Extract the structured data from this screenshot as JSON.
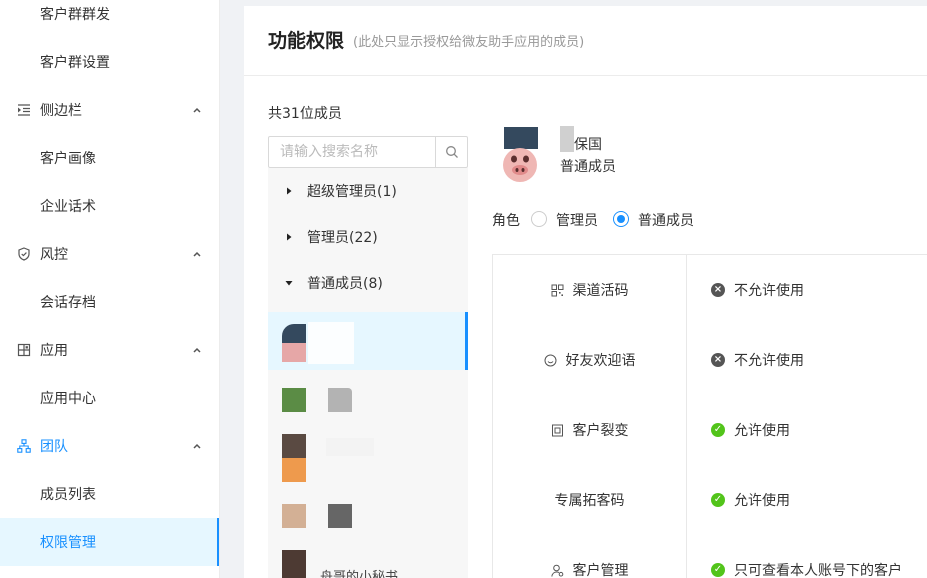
{
  "sidebar": {
    "items": [
      {
        "label": "客户群群发",
        "kind": "sub"
      },
      {
        "label": "客户群设置",
        "kind": "sub"
      },
      {
        "label": "侧边栏",
        "kind": "group",
        "icon": "indent-icon"
      },
      {
        "label": "客户画像",
        "kind": "sub"
      },
      {
        "label": "企业话术",
        "kind": "sub"
      },
      {
        "label": "风控",
        "kind": "group",
        "icon": "shield-icon"
      },
      {
        "label": "会话存档",
        "kind": "sub"
      },
      {
        "label": "应用",
        "kind": "group",
        "icon": "apps-icon"
      },
      {
        "label": "应用中心",
        "kind": "sub"
      },
      {
        "label": "团队",
        "kind": "group",
        "icon": "org-icon"
      },
      {
        "label": "成员列表",
        "kind": "sub"
      },
      {
        "label": "权限管理",
        "kind": "sub"
      }
    ]
  },
  "header": {
    "title": "功能权限",
    "subtitle": "(此处只显示授权给微友助手应用的成员)"
  },
  "members": {
    "count_label": "共31位成员",
    "search_placeholder": "请输入搜索名称",
    "groups": [
      {
        "label": "超级管理员(1)",
        "expanded": false
      },
      {
        "label": "管理员(22)",
        "expanded": false
      },
      {
        "label": "普通成员(8)",
        "expanded": true
      }
    ],
    "rows": [
      {
        "name": "",
        "selected": true
      },
      {
        "name": "",
        "selected": false
      },
      {
        "name": "",
        "selected": false
      },
      {
        "name": "",
        "selected": false
      },
      {
        "name": "舟哥的小秘书",
        "selected": false
      }
    ]
  },
  "detail": {
    "name": "保国",
    "role_text": "普通成员",
    "role_label": "角色",
    "role_options": [
      {
        "label": "管理员",
        "checked": false
      },
      {
        "label": "普通成员",
        "checked": true
      }
    ]
  },
  "permissions": [
    {
      "feature": "渠道活码",
      "icon": "qrcode-icon",
      "status": "不允许使用",
      "allowed": false
    },
    {
      "feature": "好友欢迎语",
      "icon": "smile-icon",
      "status": "不允许使用",
      "allowed": false
    },
    {
      "feature": "客户裂变",
      "icon": "split-icon",
      "status": "允许使用",
      "allowed": true
    },
    {
      "feature": "专属拓客码",
      "icon": "",
      "status": "允许使用",
      "allowed": true
    },
    {
      "feature": "客户管理",
      "icon": "user-manage-icon",
      "status": "只可查看本人账号下的客户",
      "allowed": true
    }
  ],
  "colors": {
    "accent": "#1890ff",
    "allow": "#52c41a",
    "deny": "#555555"
  }
}
